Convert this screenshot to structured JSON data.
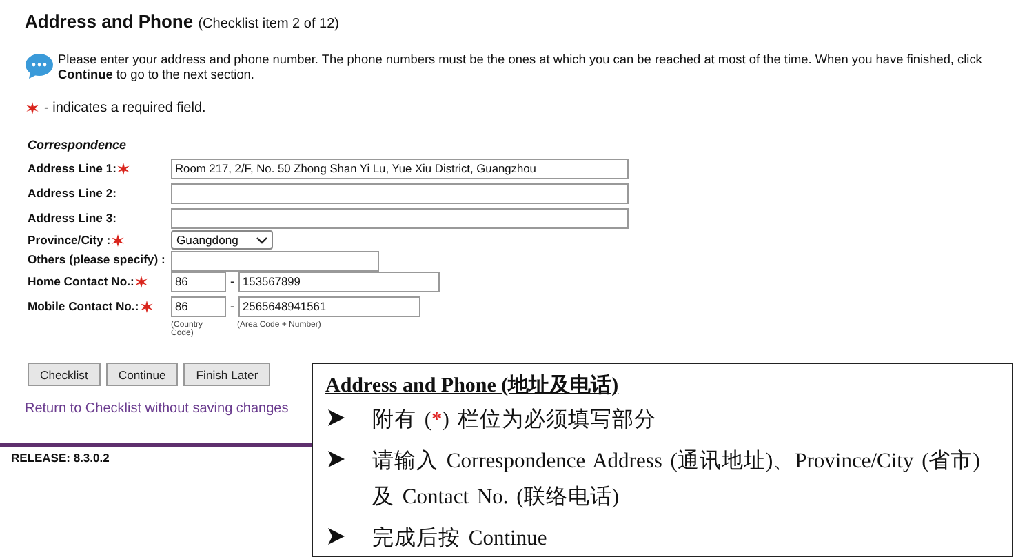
{
  "header": {
    "title": "Address and Phone",
    "subtitle": "(Checklist item 2 of 12)"
  },
  "info": {
    "text": "Please enter your address and phone number. The phone numbers must be the ones at which you can be reached at most of the time. When you have finished, click **Continue** to go to the next section."
  },
  "legend": {
    "text": "- indicates a required field."
  },
  "section": {
    "title": "Correspondence",
    "fields": [
      {
        "kind": "text",
        "label": "Address Line 1:",
        "required": true,
        "value": "Room 217, 2/F, No. 50 Zhong Shan Yi Lu, Yue Xiu District, Guangzhou"
      },
      {
        "kind": "text",
        "label": "Address Line 2:",
        "required": false
      },
      {
        "kind": "text",
        "label": "Address Line 3:",
        "required": false
      },
      {
        "kind": "select",
        "label": "Province/City :",
        "required": true,
        "value": "Guangdong"
      },
      {
        "kind": "short",
        "label": "Others (please specify) :",
        "required": false
      },
      {
        "kind": "phone",
        "label": "Home Contact No.:",
        "required": true,
        "country": "86",
        "separator": "-",
        "number": "153567899"
      },
      {
        "kind": "phone",
        "label": "Mobile Contact No.:",
        "required": true,
        "country": "86",
        "separator": "-",
        "number": "2565648941561"
      }
    ],
    "hints": [
      "(Country Code)",
      "(Area Code + Number)"
    ]
  },
  "buttons": [
    "Checklist",
    "Continue",
    "Finish Later"
  ],
  "link": "Return to Checklist without saving changes",
  "release": "RELEASE: 8.3.0.2",
  "note": {
    "title": "Address and Phone (地址及电话)",
    "bullets": [
      [
        {
          "text": "附有 ("
        },
        {
          "text": "*",
          "highlight": true
        },
        {
          "text": ") 栏位为必须填写部分"
        }
      ],
      [
        {
          "text": "请输入 Correspondence Address (通讯地址)、Province/City (省市) 及 Contact No. (联络电话)"
        }
      ],
      [
        {
          "text": "完成后按 Continue"
        }
      ]
    ]
  }
}
